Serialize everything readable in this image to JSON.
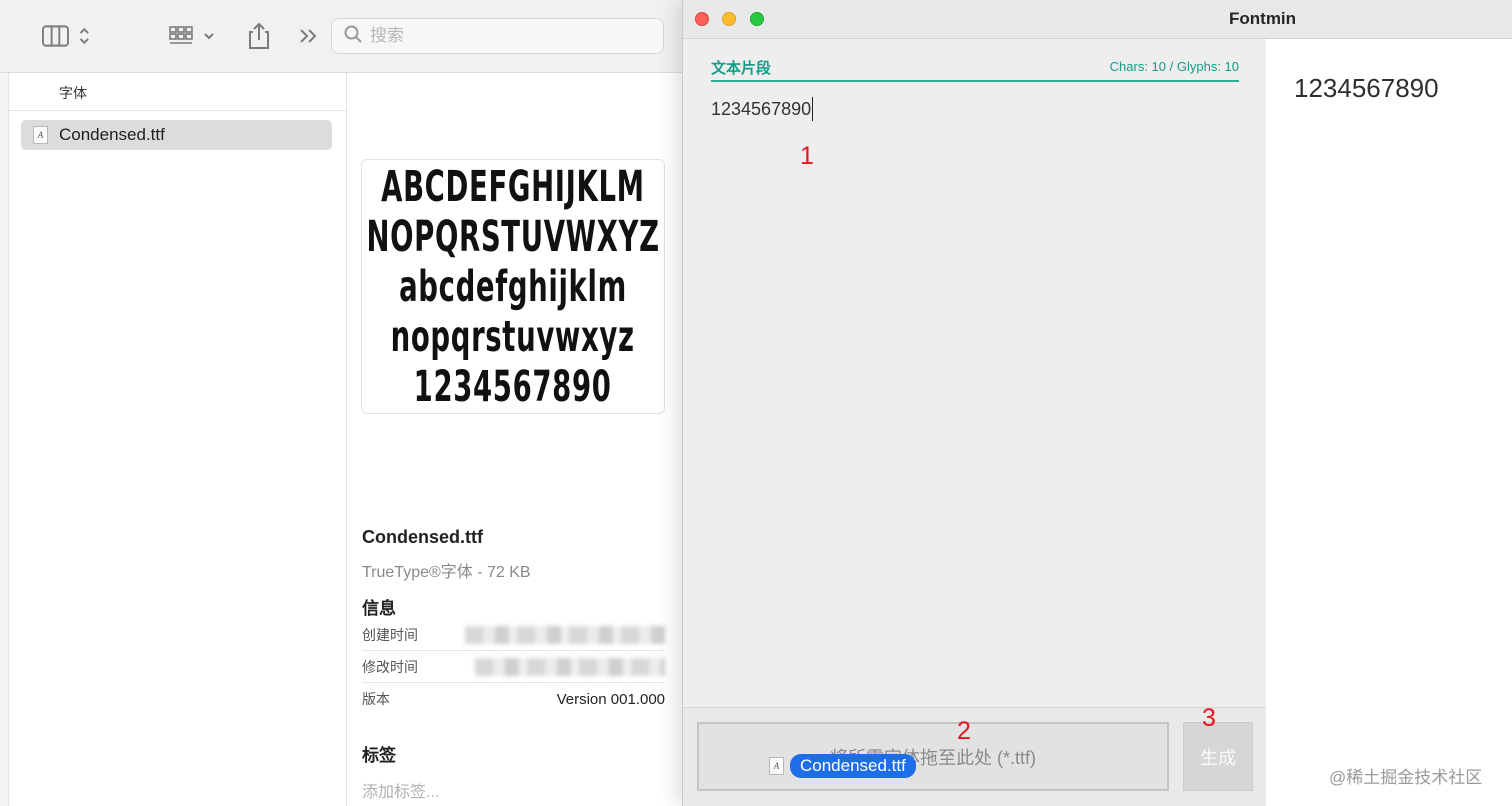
{
  "finder": {
    "search_placeholder": "搜索",
    "list_header": "字体",
    "selected_file": "Condensed.ttf",
    "file_icon_glyph": "A",
    "preview_lines": [
      "ABCDEFGHIJKLM",
      "NOPQRSTUVWXYZ",
      "abcdefghijklm",
      "nopqrstuvwxyz",
      "1234567890"
    ],
    "info": {
      "title": "Condensed.ttf",
      "subtitle": "TrueType®字体 - 72 KB",
      "section": "信息",
      "created_label": "创建时间",
      "modified_label": "修改时间",
      "version_label": "版本",
      "version_value": "Version 001.000",
      "tags_title": "标签",
      "tags_placeholder": "添加标签..."
    }
  },
  "fontmin": {
    "window_title": "Fontmin",
    "tab_label": "文本片段",
    "stats": "Chars: 10 / Glyphs: 10",
    "input_text": "1234567890",
    "result_text": "1234567890",
    "drop_hint": "将所需字体拖至此处 (*.ttf)",
    "drag_file": "Condensed.ttf",
    "generate_label": "生成"
  },
  "annotations": [
    "1",
    "2",
    "3"
  ],
  "watermark": "@稀土掘金技术社区",
  "colors": {
    "accent_teal": "#139c86",
    "step_red": "#e8141c",
    "drag_blue": "#1d6ee8"
  }
}
